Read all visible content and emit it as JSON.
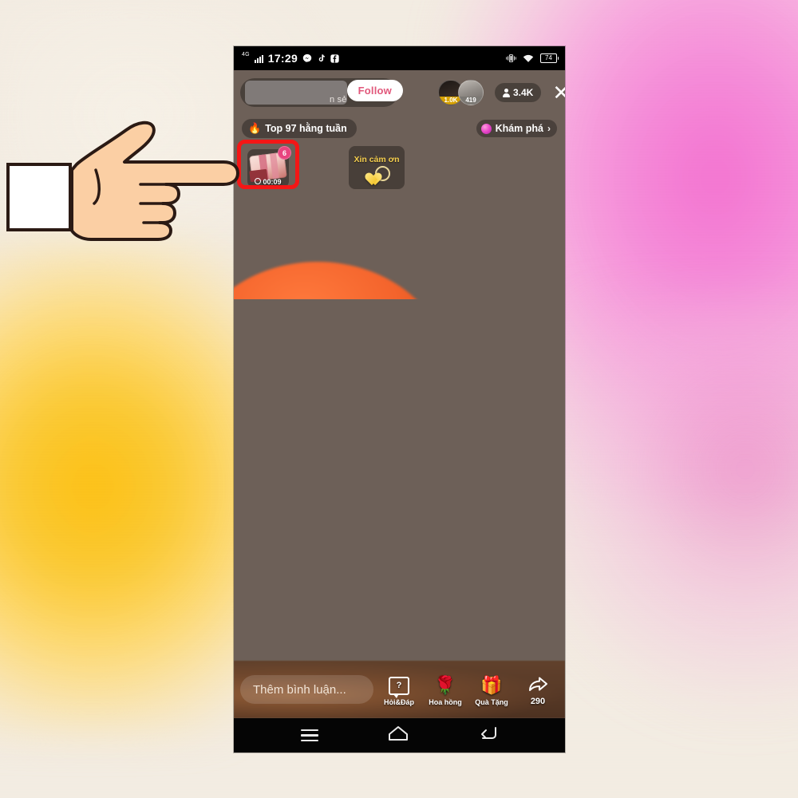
{
  "background": {
    "base_color": "#f3ece2",
    "accent_pink": "#f472d0",
    "accent_yellow": "#fcc013"
  },
  "cursor": {
    "type": "pointing-hand",
    "skin_color": "#fbcfa4",
    "outline_color": "#2b1a14",
    "cuff_color": "#ffffff"
  },
  "phone": {
    "status_bar": {
      "network_label": "4G",
      "time": "17:29",
      "app_icons": [
        "messenger-icon",
        "tiktok-icon",
        "facebook-icon"
      ],
      "right_icons": [
        "vibrate-icon",
        "wifi-icon"
      ],
      "battery_level": "74"
    },
    "live": {
      "top_bar": {
        "streamer_name_fragment": "n sẻ",
        "follow_label": "Follow",
        "viewers": [
          {
            "badge": "1.0K",
            "badge_color": "#d6a100",
            "name": "top-viewer-1"
          },
          {
            "badge": "419",
            "badge_color": "#7b7873",
            "name": "top-viewer-2"
          }
        ],
        "viewer_count": "3.4K",
        "viewer_icon": "person-icon",
        "close_icon": "close-icon"
      },
      "second_row": {
        "rank_icon": "fire-icon",
        "rank_label": "Top 97 hằng tuần",
        "explore_icon": "orb-icon",
        "explore_label": "Khám phá",
        "explore_chevron": "›"
      },
      "gift_card": {
        "name": "gift-box-timer",
        "badge_count": "6",
        "timer": "00:09",
        "timer_icon": "clock-icon",
        "highlighted": true,
        "highlight_color": "#f41616"
      },
      "thanks_card": {
        "label": "Xin cảm ơn",
        "label_color": "#f6cf4e",
        "icons": [
          "heart-icon",
          "ring-icon"
        ]
      }
    },
    "bottom_bar": {
      "comment_placeholder": "Thêm bình luận...",
      "actions": [
        {
          "icon": "question-mark-icon",
          "glyph": "?",
          "label": "Hỏi&Đáp"
        },
        {
          "icon": "rose-icon",
          "glyph": "🌹",
          "label": "Hoa hồng"
        },
        {
          "icon": "gift-icon",
          "glyph": "🎁",
          "label": "Quà Tặng"
        },
        {
          "icon": "share-icon",
          "glyph": "",
          "label": "290"
        }
      ]
    },
    "nav_bar": {
      "buttons": [
        {
          "name": "recent-apps-button",
          "icon": "menu-icon"
        },
        {
          "name": "home-button",
          "icon": "home-icon"
        },
        {
          "name": "back-button",
          "icon": "back-icon"
        }
      ]
    }
  }
}
